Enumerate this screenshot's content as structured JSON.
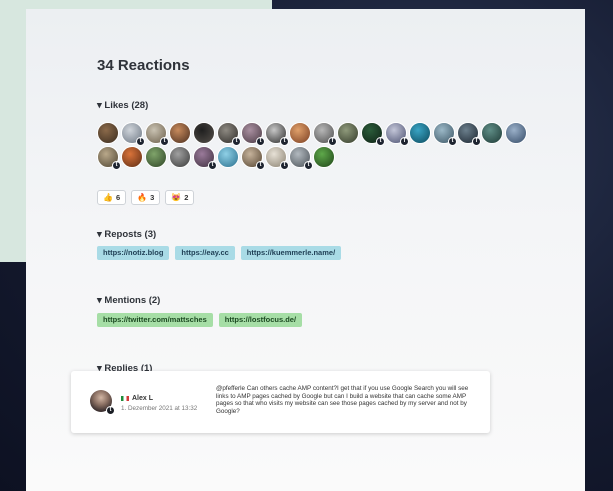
{
  "title": "34 Reactions",
  "likes": {
    "label": "▾ Likes (28)",
    "avatars": [
      {
        "c1": "#8b6a4a",
        "c2": "#3a2c1f",
        "badge": ""
      },
      {
        "c1": "#cfd4da",
        "c2": "#6c7683",
        "badge": "twitter"
      },
      {
        "c1": "#c9c2b2",
        "c2": "#6b5e4a",
        "badge": "twitter"
      },
      {
        "c1": "#c78a5c",
        "c2": "#4a2e1f",
        "badge": ""
      },
      {
        "c1": "#1f1f1f",
        "c2": "#55504a",
        "badge": ""
      },
      {
        "c1": "#8e8a82",
        "c2": "#2e2b28",
        "badge": "twitter"
      },
      {
        "c1": "#a98fa0",
        "c2": "#4a3a44",
        "badge": "twitter"
      },
      {
        "c1": "#c7c7c7",
        "c2": "#2a2a2a",
        "badge": "twitter"
      },
      {
        "c1": "#e0a06a",
        "c2": "#7a3e22",
        "badge": ""
      },
      {
        "c1": "#b7b7b7",
        "c2": "#4d4d4d",
        "badge": "facebook"
      },
      {
        "c1": "#8f9a7b",
        "c2": "#333a2a",
        "badge": ""
      },
      {
        "c1": "#2b5c3a",
        "c2": "#0f2216",
        "badge": "twitter"
      },
      {
        "c1": "#c3c6d8",
        "c2": "#4a4f70",
        "badge": "facebook"
      },
      {
        "c1": "#39a4c4",
        "c2": "#0c4a5e",
        "badge": ""
      },
      {
        "c1": "#9bb8c7",
        "c2": "#3b5564",
        "badge": "twitter"
      },
      {
        "c1": "#6b7f8c",
        "c2": "#1c2530",
        "badge": "facebook"
      },
      {
        "c1": "#5f8d86",
        "c2": "#1e3a36",
        "badge": ""
      },
      {
        "c1": "#9ab0c9",
        "c2": "#344a66",
        "badge": ""
      },
      {
        "c1": "#b9a88a",
        "c2": "#4f4533",
        "badge": "twitter"
      },
      {
        "c1": "#d9733a",
        "c2": "#5e2c14",
        "badge": ""
      },
      {
        "c1": "#7fa46a",
        "c2": "#2e4426",
        "badge": ""
      },
      {
        "c1": "#a0a0a0",
        "c2": "#3a3a3a",
        "badge": ""
      },
      {
        "c1": "#9a7a9a",
        "c2": "#3e2f3e",
        "badge": "twitter"
      },
      {
        "c1": "#8fd0e6",
        "c2": "#2a6f8e",
        "badge": ""
      },
      {
        "c1": "#c6b39c",
        "c2": "#554431",
        "badge": "twitter"
      },
      {
        "c1": "#e7e1d6",
        "c2": "#8a8171",
        "badge": "twitter"
      },
      {
        "c1": "#b2b9bf",
        "c2": "#4a5157",
        "badge": "twitter"
      },
      {
        "c1": "#5ea84a",
        "c2": "#1f4418",
        "badge": ""
      }
    ],
    "emoji_counts": [
      {
        "icon": "👍",
        "count": "6"
      },
      {
        "icon": "🔥",
        "count": "3"
      },
      {
        "icon": "😻",
        "count": "2"
      }
    ]
  },
  "reposts": {
    "label": "▾ Reposts (3)",
    "links": [
      "https://notiz.blog",
      "https://eay.cc",
      "https://kuemmerle.name/"
    ]
  },
  "mentions": {
    "label": "▾ Mentions (2)",
    "links": [
      "https://twitter.com/mattsches",
      "https://lostfocus.de/"
    ]
  },
  "replies": {
    "label": "▾ Replies (1)",
    "items": [
      {
        "name": "Alex L",
        "date": "1. Dezember 2021 at 13:32",
        "text": "@pfefferle Can others cache AMP content?I get that if you use Google Search you will see links to AMP pages cached by Google but can I build a website that can cache some AMP pages so that who visits my website can see those pages cached by my server and not by Google?"
      }
    ]
  },
  "colors": {
    "repost_chip": "#a9dbe6",
    "mention_chip": "#a6dea6",
    "mint_panel": "#d7e7df"
  }
}
